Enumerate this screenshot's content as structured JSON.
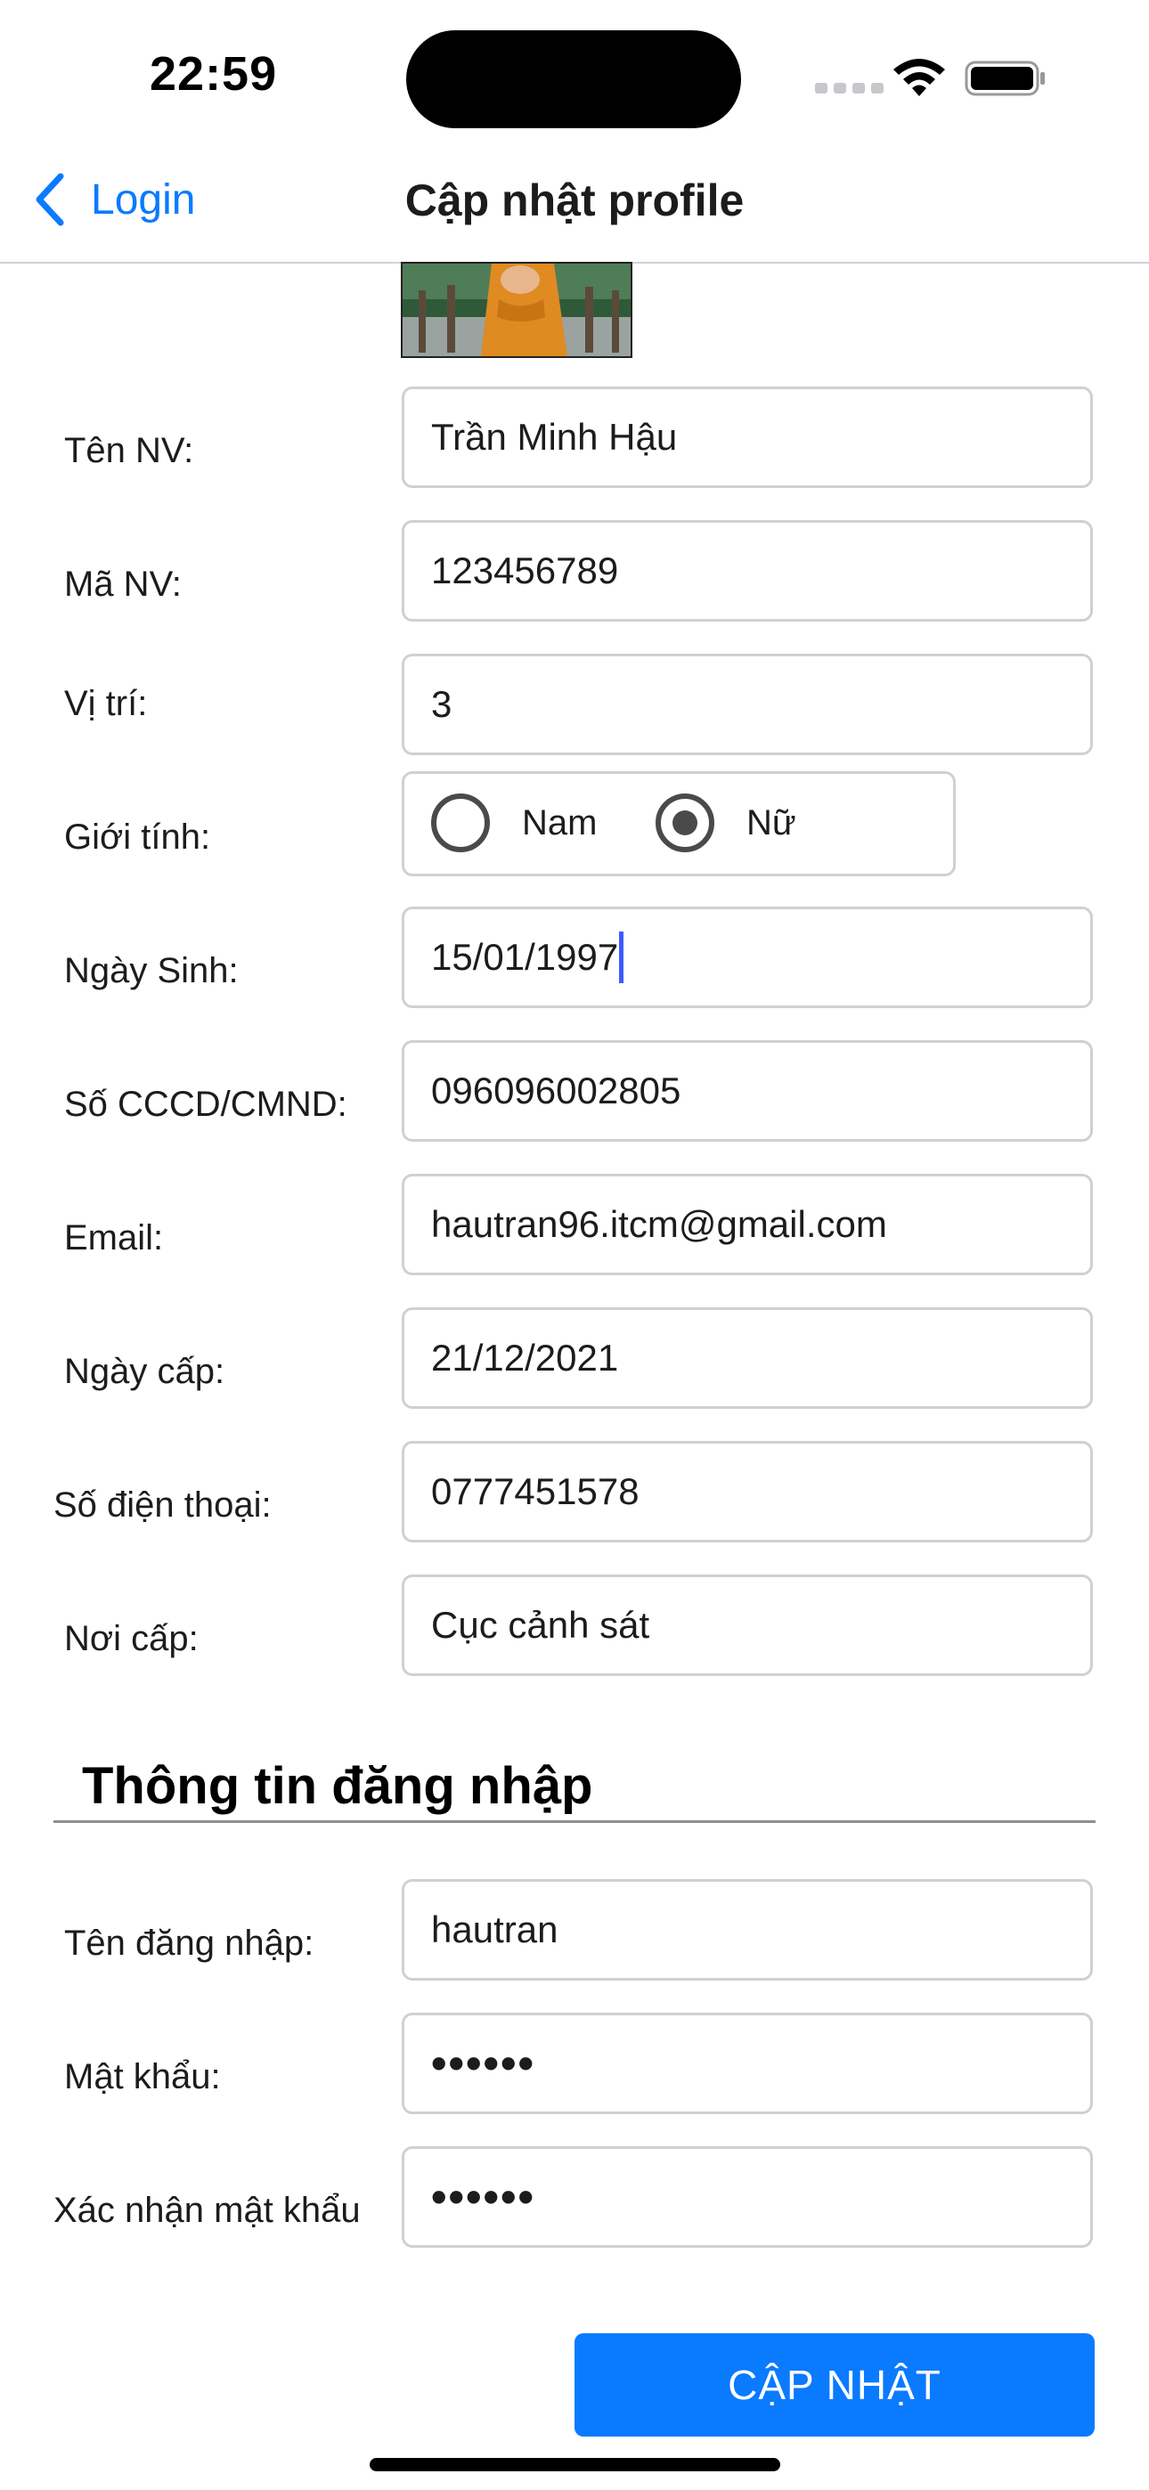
{
  "status_bar": {
    "time": "22:59"
  },
  "nav": {
    "back_label": "Login",
    "title": "Cập nhật profile"
  },
  "form": {
    "employee_name": {
      "label": "Tên NV:",
      "value": "Trần Minh Hậu"
    },
    "employee_id": {
      "label": "Mã NV:",
      "value": "123456789"
    },
    "position": {
      "label": "Vị trí:",
      "value": "3"
    },
    "gender": {
      "label": "Giới tính:",
      "options": [
        "Nam",
        "Nữ"
      ],
      "selected": "Nữ"
    },
    "birth_date": {
      "label": "Ngày Sinh:",
      "value": "15/01/1997"
    },
    "id_number": {
      "label": "Số CCCD/CMND:",
      "value": "096096002805"
    },
    "email": {
      "label": "Email:",
      "value": "hautran96.itcm@gmail.com"
    },
    "issue_date": {
      "label": "Ngày cấp:",
      "value": "21/12/2021"
    },
    "phone": {
      "label": "Số điện thoại:",
      "value": "0777451578"
    },
    "issue_place": {
      "label": "Nơi cấp:",
      "value": "Cục cảnh sát"
    }
  },
  "login_section": {
    "title": "Thông tin đăng nhập",
    "username": {
      "label": "Tên đăng nhập:",
      "value": "hautran"
    },
    "password": {
      "label": "Mật khẩu:",
      "value": "••••••"
    },
    "confirm_password": {
      "label": "Xác nhận mật khẩu",
      "value": "••••••"
    }
  },
  "submit_label": "CẬP NHẬT",
  "colors": {
    "accent": "#0a7aff",
    "border": "#d0d0d4",
    "caret": "#3d5afe"
  }
}
